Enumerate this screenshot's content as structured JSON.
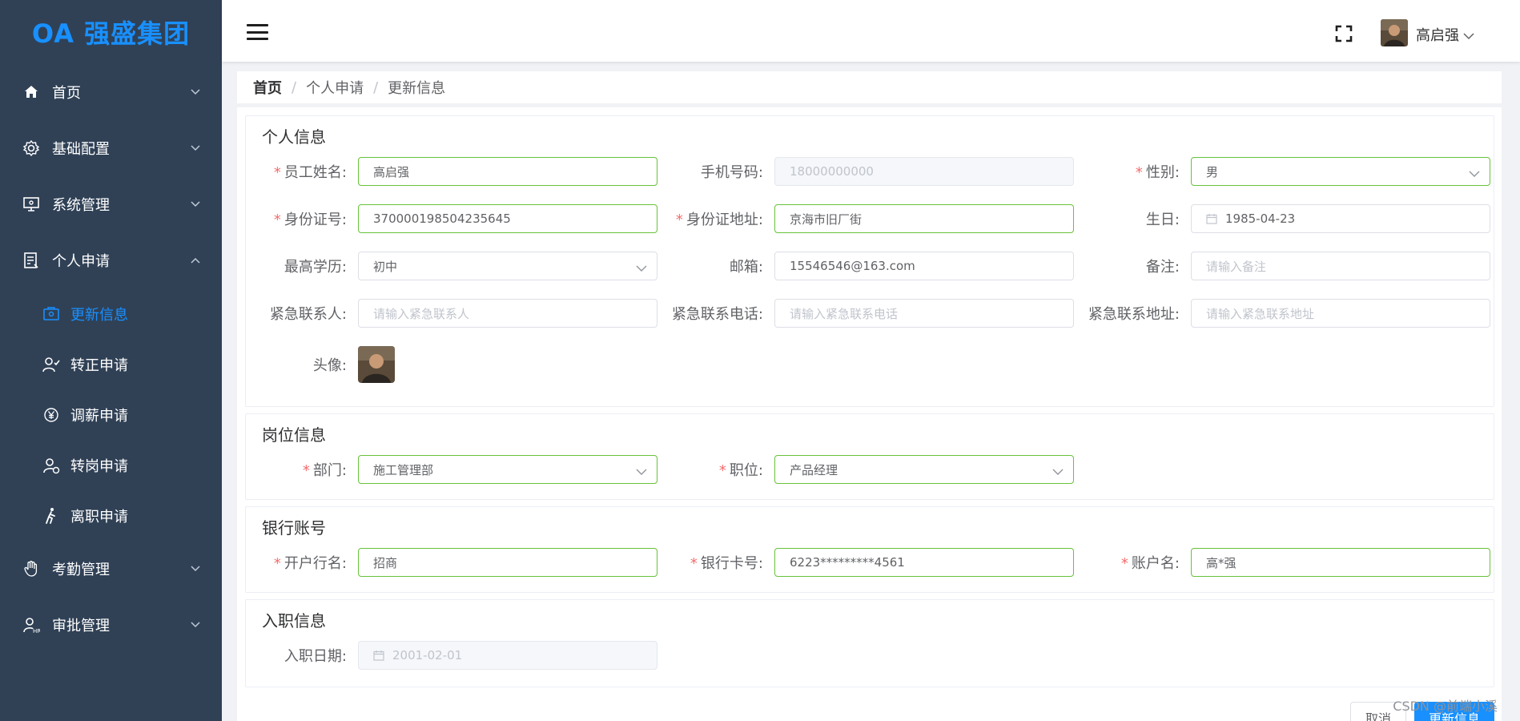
{
  "brand": {
    "logo": "OA 强盛集团"
  },
  "sidebar": {
    "items": [
      {
        "label": "首页",
        "icon": "home-icon"
      },
      {
        "label": "基础配置",
        "icon": "gear-icon"
      },
      {
        "label": "系统管理",
        "icon": "monitor-icon"
      },
      {
        "label": "个人申请",
        "icon": "document-icon"
      },
      {
        "label": "考勤管理",
        "icon": "hand-icon"
      },
      {
        "label": "审批管理",
        "icon": "user-hr-icon"
      }
    ],
    "sub_items": [
      {
        "label": "更新信息",
        "icon": "id-card-icon",
        "active": true
      },
      {
        "label": "转正申请",
        "icon": "user-check-icon"
      },
      {
        "label": "调薪申请",
        "icon": "yen-icon"
      },
      {
        "label": "转岗申请",
        "icon": "user-swap-icon"
      },
      {
        "label": "离职申请",
        "icon": "walking-icon"
      }
    ]
  },
  "header": {
    "user_name": "高启强"
  },
  "breadcrumb": {
    "items": [
      "首页",
      "个人申请",
      "更新信息"
    ],
    "separator": "/"
  },
  "sections": {
    "personal": {
      "title": "个人信息",
      "name_label": "员工姓名:",
      "name_value": "高启强",
      "phone_label": "手机号码:",
      "phone_value": "18000000000",
      "gender_label": "性别:",
      "gender_value": "男",
      "idno_label": "身份证号:",
      "idno_value": "370000198504235645",
      "idaddr_label": "身份证地址:",
      "idaddr_value": "京海市旧厂街",
      "birthday_label": "生日:",
      "birthday_value": "1985-04-23",
      "edu_label": "最高学历:",
      "edu_value": "初中",
      "email_label": "邮箱:",
      "email_value": "15546546@163.com",
      "remark_label": "备注:",
      "remark_placeholder": "请输入备注",
      "ec_name_label": "紧急联系人:",
      "ec_name_placeholder": "请输入紧急联系人",
      "ec_phone_label": "紧急联系电话:",
      "ec_phone_placeholder": "请输入紧急联系电话",
      "ec_addr_label": "紧急联系地址:",
      "ec_addr_placeholder": "请输入紧急联系地址",
      "avatar_label": "头像:"
    },
    "position": {
      "title": "岗位信息",
      "dept_label": "部门:",
      "dept_value": "施工管理部",
      "job_label": "职位:",
      "job_value": "产品经理"
    },
    "bank": {
      "title": "银行账号",
      "bank_label": "开户行名:",
      "bank_value": "招商",
      "card_label": "银行卡号:",
      "card_value": "6223*********4561",
      "account_label": "账户名:",
      "account_value": "高*强"
    },
    "entry": {
      "title": "入职信息",
      "date_label": "入职日期:",
      "date_value": "2001-02-01"
    }
  },
  "footer": {
    "cancel_label": "取消",
    "submit_label": "更新信息"
  },
  "watermark": "CSDN @前端小溪",
  "colors": {
    "sidebar_bg": "#304156",
    "accent": "#1890ff",
    "valid": "#67c23a",
    "required": "#f56c6c"
  }
}
